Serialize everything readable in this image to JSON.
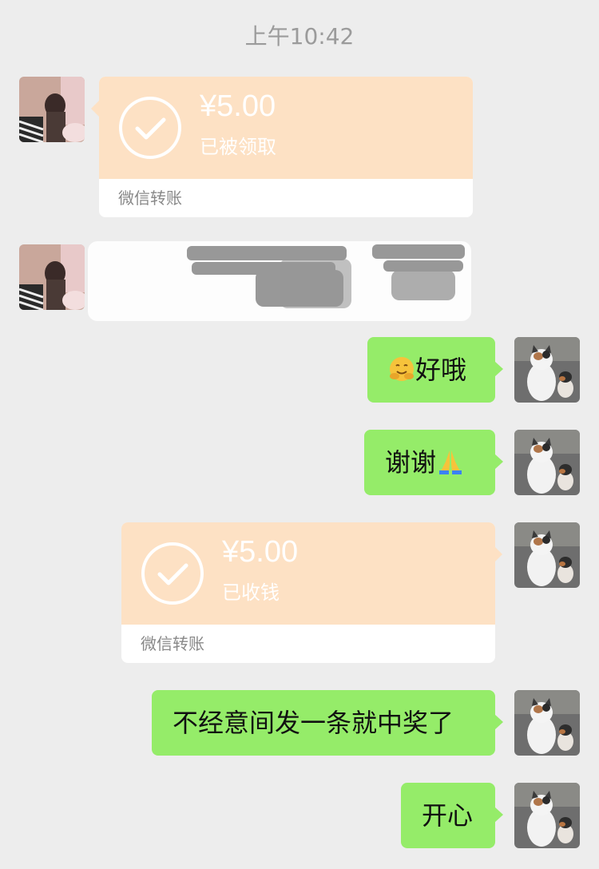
{
  "chat": {
    "timestamp": "上午10:42",
    "transfer_received": {
      "amount": "¥5.00",
      "status": "已被领取",
      "footer": "微信转账"
    },
    "transfer_sent": {
      "amount": "¥5.00",
      "status": "已收钱",
      "footer": "微信转账"
    },
    "messages": [
      {
        "text": "好哦",
        "emoji": "hugging-face"
      },
      {
        "text": "谢谢",
        "emoji": "folded-hands"
      },
      {
        "text": "不经意间发一条就中奖了"
      },
      {
        "text": "开心"
      }
    ]
  },
  "colors": {
    "background": "#ededed",
    "bubble_green": "#95ec69",
    "transfer_peach": "#fde1c4"
  }
}
